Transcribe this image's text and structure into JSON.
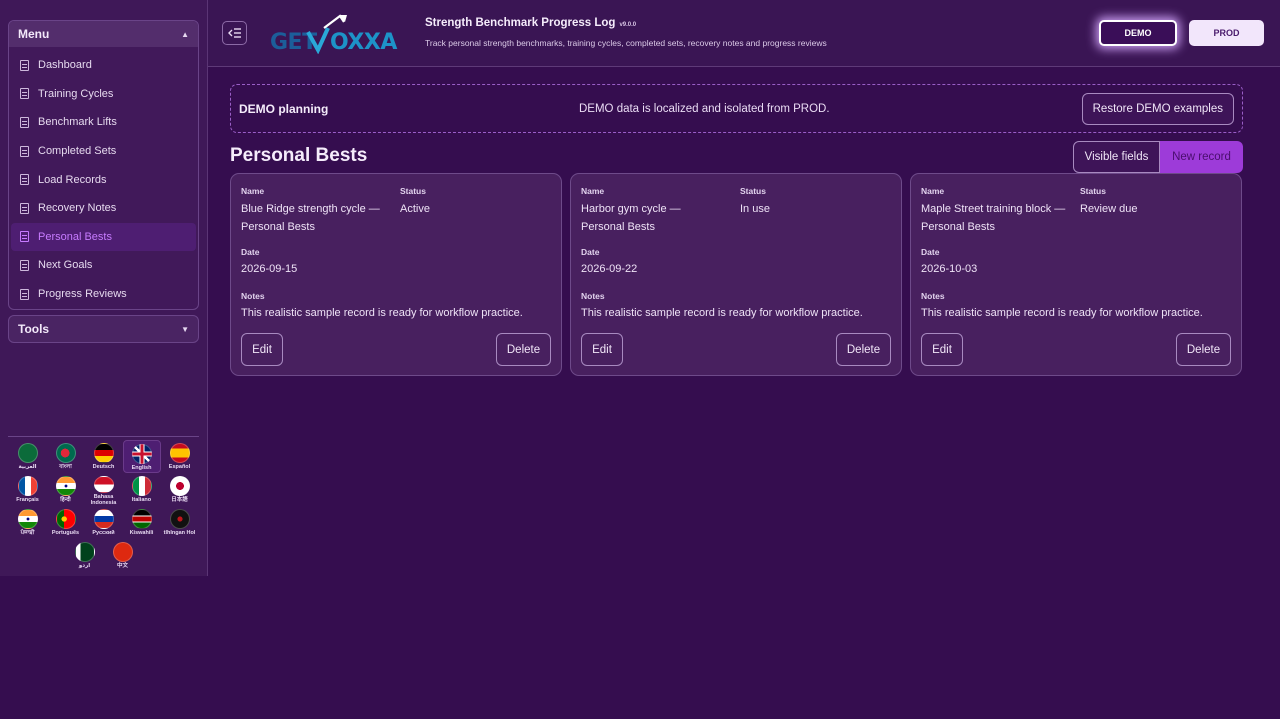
{
  "sidebar": {
    "menu_title": "Menu",
    "items": [
      {
        "label": "Dashboard"
      },
      {
        "label": "Training Cycles"
      },
      {
        "label": "Benchmark Lifts"
      },
      {
        "label": "Completed Sets"
      },
      {
        "label": "Load Records"
      },
      {
        "label": "Recovery Notes"
      },
      {
        "label": "Personal Bests",
        "active": true
      },
      {
        "label": "Next Goals"
      },
      {
        "label": "Progress Reviews"
      }
    ],
    "tools_title": "Tools",
    "languages": [
      {
        "name": "العربية",
        "flag": "sa"
      },
      {
        "name": "বাংলা",
        "flag": "bd"
      },
      {
        "name": "Deutsch",
        "flag": "de"
      },
      {
        "name": "English",
        "flag": "gb",
        "selected": true
      },
      {
        "name": "Español",
        "flag": "es"
      },
      {
        "name": "Français",
        "flag": "fr"
      },
      {
        "name": "हिन्दी",
        "flag": "in"
      },
      {
        "name": "Bahasa Indonesia",
        "flag": "id"
      },
      {
        "name": "Italiano",
        "flag": "it"
      },
      {
        "name": "日本語",
        "flag": "jp"
      },
      {
        "name": "ਪੰਜਾਬੀ",
        "flag": "in"
      },
      {
        "name": "Português",
        "flag": "pt"
      },
      {
        "name": "Русский",
        "flag": "ru"
      },
      {
        "name": "Kiswahili",
        "flag": "ke"
      },
      {
        "name": "tlhIngan Hol",
        "flag": "kl"
      },
      {
        "name": "اردو",
        "flag": "pk"
      },
      {
        "name": "中文",
        "flag": "cn"
      }
    ]
  },
  "header": {
    "logo_text": "GETVOXXA",
    "title": "Strength Benchmark Progress Log",
    "version": "v9.0.0",
    "subtitle": "Track personal strength benchmarks, training cycles, completed sets, recovery notes and progress reviews",
    "demo_label": "DEMO",
    "prod_label": "PROD"
  },
  "banner": {
    "title": "DEMO planning",
    "text": "DEMO data is localized and isolated from PROD.",
    "restore_label": "Restore DEMO examples"
  },
  "main": {
    "page_title": "Personal Bests",
    "visible_fields_label": "Visible fields",
    "new_record_label": "New record",
    "labels": {
      "name": "Name",
      "status": "Status",
      "date": "Date",
      "notes": "Notes",
      "edit": "Edit",
      "delete": "Delete"
    },
    "cards": [
      {
        "name": "Blue Ridge strength cycle — Personal Bests",
        "status": "Active",
        "date": "2026-09-15",
        "notes": "This realistic sample record is ready for workflow practice."
      },
      {
        "name": "Harbor gym cycle — Personal Bests",
        "status": "In use",
        "date": "2026-09-22",
        "notes": "This realistic sample record is ready for workflow practice."
      },
      {
        "name": "Maple Street training block — Personal Bests",
        "status": "Review due",
        "date": "2026-10-03",
        "notes": "This realistic sample record is ready for workflow practice."
      }
    ]
  },
  "colors": {
    "background": "#350d4f",
    "sidebar": "#3f1858",
    "accent": "#9d3bd9",
    "active_text": "#c77bff"
  }
}
